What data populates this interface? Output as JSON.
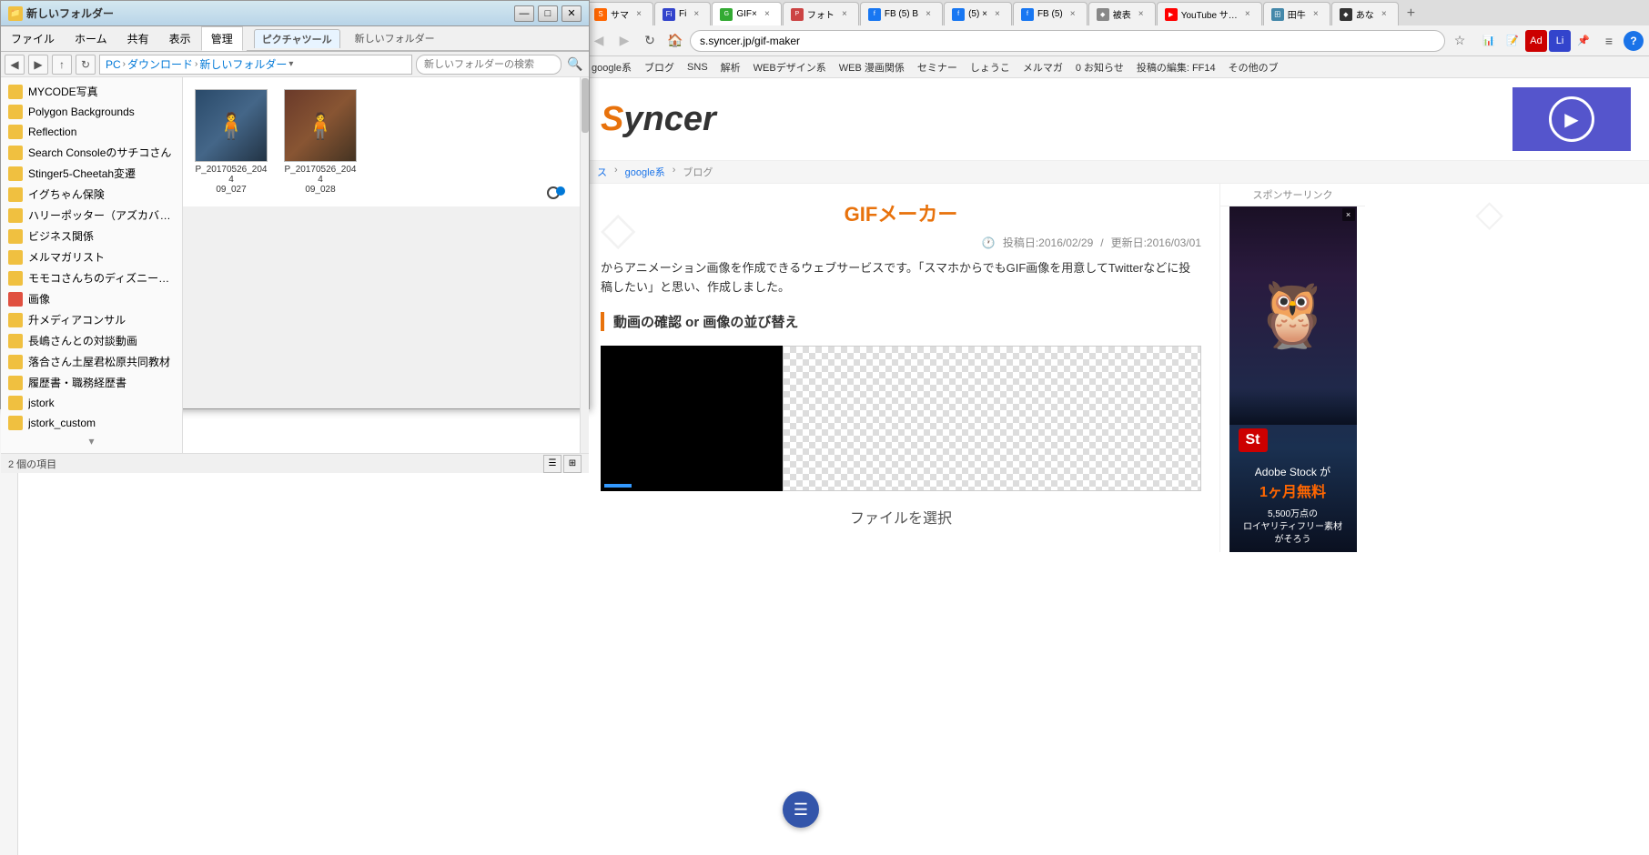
{
  "browser": {
    "tabs": [
      {
        "id": "tab1",
        "label": "サマ",
        "active": false,
        "favicon": "S"
      },
      {
        "id": "tab2",
        "label": "Fi",
        "active": false,
        "favicon": "F"
      },
      {
        "id": "tab3",
        "label": "GIF×",
        "active": false,
        "favicon": "G"
      },
      {
        "id": "tab4",
        "label": "フォト",
        "active": false,
        "favicon": "P"
      },
      {
        "id": "tab5",
        "label": "FB (5) B",
        "active": false,
        "favicon": "f"
      },
      {
        "id": "tab6",
        "label": "(5) ×",
        "active": false,
        "favicon": "f"
      },
      {
        "id": "tab7",
        "label": "FB (5)",
        "active": false,
        "favicon": "f"
      },
      {
        "id": "tab8",
        "label": "被表",
        "active": false,
        "favicon": "◆"
      },
      {
        "id": "tab9",
        "label": "YouTube サ…",
        "active": false,
        "favicon": "▶"
      },
      {
        "id": "tab10",
        "label": "田牛",
        "active": false,
        "favicon": "田"
      },
      {
        "id": "tab11",
        "label": "あな",
        "active": false,
        "favicon": "◆"
      }
    ],
    "address": "s.syncer.jp/gif-maker",
    "help_btn": "?",
    "star_icon": "☆"
  },
  "bookmarks": [
    "google系",
    "ブログ",
    "SNS",
    "解析",
    "WEBデザイン系",
    "WEB 漫画関係",
    "セミナー",
    "しょうこ",
    "メルマガ",
    "0 お知らせ",
    "投稿の編集: FF14",
    "その他のブ"
  ],
  "explorer": {
    "title": "新しいフォルダー",
    "toolbar_tabs": [
      "ファイル",
      "ホーム",
      "共有",
      "表示",
      "管理"
    ],
    "active_tab": "ピクチャツール",
    "ribbon_label": "ピクチャツール",
    "new_folder_btn": "新しいフォルダー",
    "minimize": "—",
    "maximize": "□",
    "close": "✕",
    "breadcrumb": [
      "PC",
      "ダウンロード",
      "新しいフォルダー"
    ],
    "search_placeholder": "新しいフォルダーの検索",
    "sidebar_items": [
      {
        "label": "MYCODE写真",
        "icon": "yellow"
      },
      {
        "label": "Polygon Backgrounds",
        "icon": "yellow"
      },
      {
        "label": "Reflection",
        "icon": "yellow"
      },
      {
        "label": "Search Consoleのサチコさん",
        "icon": "yellow"
      },
      {
        "label": "Stinger5-Cheetah変遷",
        "icon": "yellow"
      },
      {
        "label": "イグちゃん保険",
        "icon": "yellow"
      },
      {
        "label": "ハリーポッター（アズカバン）",
        "icon": "yellow"
      },
      {
        "label": "ビジネス関係",
        "icon": "yellow"
      },
      {
        "label": "メルマガリスト",
        "icon": "yellow"
      },
      {
        "label": "モモコさんちのディズニー（親子でデ",
        "icon": "yellow"
      },
      {
        "label": "画像",
        "icon": "red"
      },
      {
        "label": "升メディアコンサル",
        "icon": "yellow"
      },
      {
        "label": "長嶋さんとの対談動画",
        "icon": "yellow"
      },
      {
        "label": "落合さん土屋君松原共同教材",
        "icon": "yellow"
      },
      {
        "label": "履歴書・職務経歴書",
        "icon": "yellow"
      },
      {
        "label": "jstork",
        "icon": "yellow"
      },
      {
        "label": "jstork_custom",
        "icon": "yellow"
      }
    ],
    "files": [
      {
        "name": "P_20170526_204409_027",
        "thumb_color": "#446688"
      },
      {
        "name": "P_20170526_204409_028",
        "thumb_color": "#885533"
      }
    ],
    "status": "2 個の項目",
    "scroll_visible": true
  },
  "syncer": {
    "logo": "Syncer",
    "page_title": "GIFメーカー",
    "post_date": "投稿日:2016/02/29",
    "update_date": "更新日:2016/03/01",
    "description": "からアニメーション画像を作成できるウェブサービスです。「スマホからでもGIF画像を用意してTwitterなどに投稿したい」と思い、作成しました。",
    "section_title": "動画の確認 or 画像の並び替え",
    "upload_label": "ファイルを選択",
    "sponsor_text": "スポンサーリンク",
    "ad_badge": "St",
    "ad_brand": "Adobe Stock が",
    "ad_subtitle": "1ヶ月無料",
    "ad_detail1": "5,500万点の",
    "ad_detail2": "ロイヤリティフリー素材",
    "ad_detail3": "がそろう"
  }
}
